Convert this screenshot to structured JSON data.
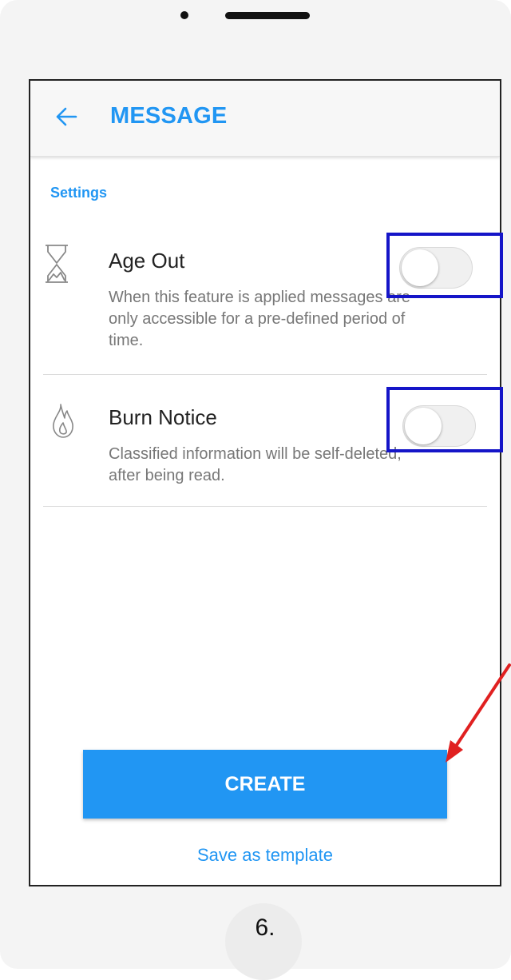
{
  "header": {
    "title": "MESSAGE"
  },
  "section_label": "Settings",
  "settings": [
    {
      "icon": "hourglass-icon",
      "title": "Age Out",
      "description": "When this feature is applied messages are only accessible for a pre-defined period of time.",
      "enabled": false
    },
    {
      "icon": "flame-icon",
      "title": "Burn Notice",
      "description": "Classified information will be self-deleted, after being read.",
      "enabled": false
    }
  ],
  "actions": {
    "create_label": "CREATE",
    "template_label": "Save as template"
  },
  "annotation": {
    "step_label": "6."
  },
  "colors": {
    "accent": "#2196f3",
    "highlight_box": "#1515c8",
    "arrow": "#e02020"
  }
}
